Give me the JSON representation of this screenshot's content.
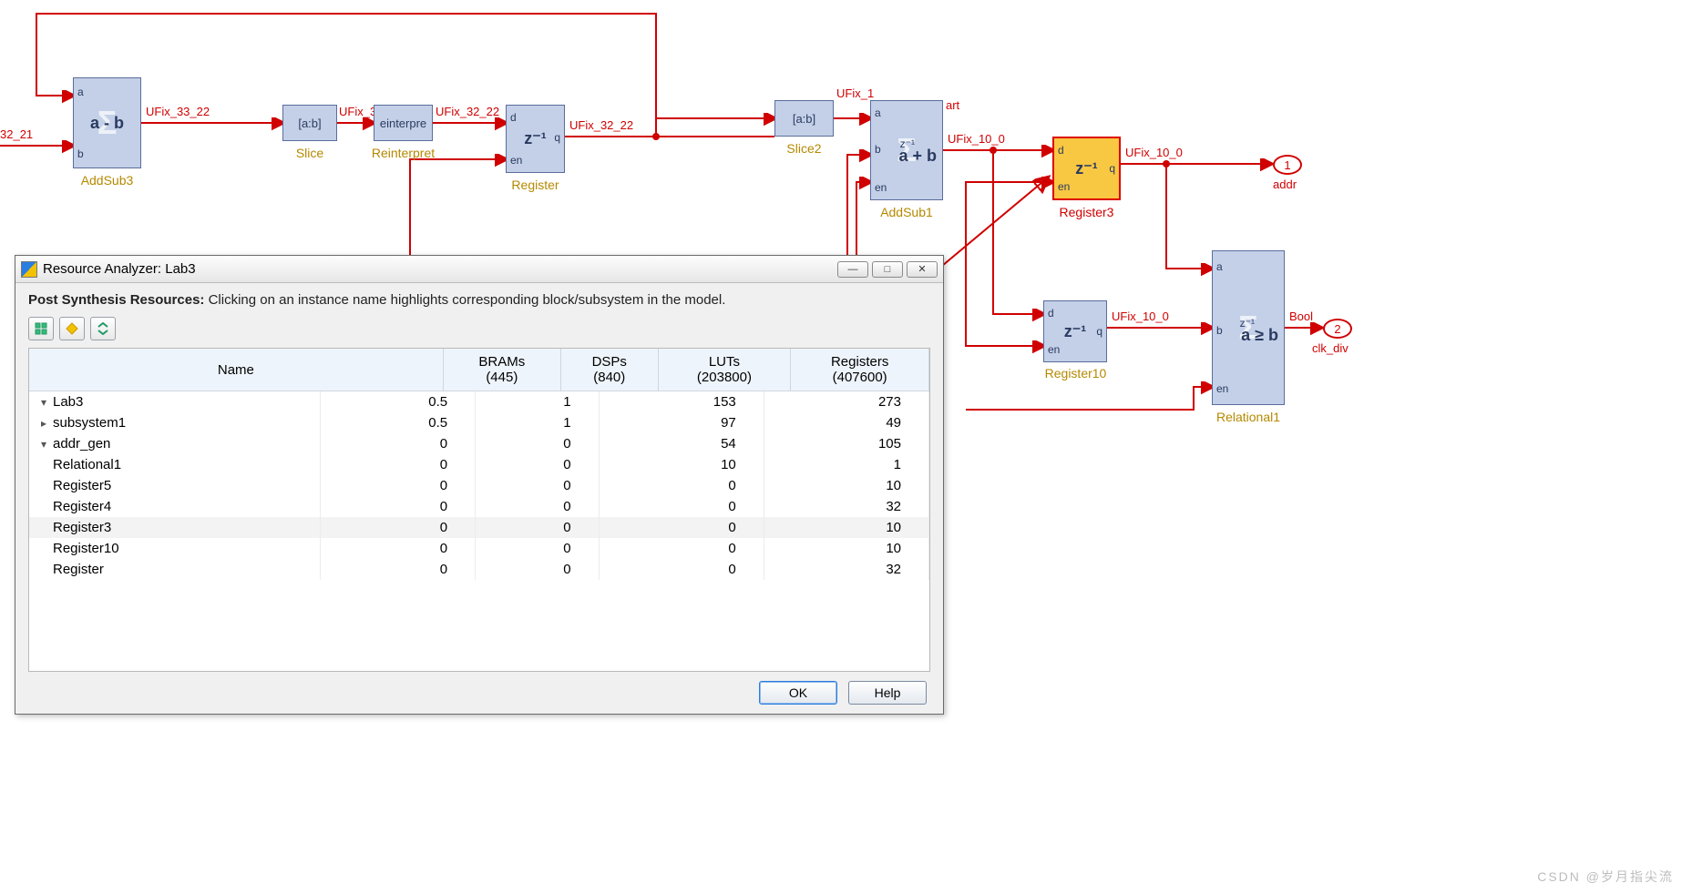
{
  "diagram": {
    "input_signal": "32_21",
    "blocks": {
      "addsub3": {
        "label": "AddSub3",
        "expr": "a - b",
        "in_a": "a",
        "in_b": "b"
      },
      "slice": {
        "label": "Slice",
        "text": "[a:b]"
      },
      "reinterpret": {
        "label": "Reinterpret",
        "text": "einterpre"
      },
      "register": {
        "label": "Register",
        "expr": "z⁻¹",
        "in_d": "d",
        "in_en": "en",
        "out_q": "q"
      },
      "slice2": {
        "label": "Slice2",
        "text": "[a:b]"
      },
      "addsub1": {
        "label": "AddSub1",
        "expr": "a + b",
        "in_a": "a",
        "in_b": "b",
        "in_en": "en",
        "z": "z⁻¹"
      },
      "register3": {
        "label": "Register3",
        "expr": "z⁻¹",
        "in_d": "d",
        "in_en": "en",
        "out_q": "q"
      },
      "register10": {
        "label": "Register10",
        "expr": "z⁻¹",
        "in_d": "d",
        "in_en": "en",
        "out_q": "q"
      },
      "relational1": {
        "label": "Relational1",
        "expr": "a ≥ b",
        "in_a": "a",
        "in_b": "b",
        "in_en": "en",
        "z": "z⁻¹"
      }
    },
    "signals": {
      "s1": "UFix_33_22",
      "s2": "UFix_3",
      "s3": "UFix_32_22",
      "s4": "UFix_32_22",
      "s5": "UFix_1",
      "s6": "art",
      "s7": "UFix_10_0",
      "s8": "UFix_10_0",
      "s9": "UFix_10_0",
      "s10": "Bool"
    },
    "outports": {
      "addr": {
        "num": "1",
        "name": "addr"
      },
      "clkdiv": {
        "num": "2",
        "name": "clk_div"
      }
    }
  },
  "dialog": {
    "title": "Resource Analyzer: Lab3",
    "instruction_bold": "Post Synthesis Resources:",
    "instruction_rest": " Clicking on an instance name highlights corresponding block/subsystem in the model.",
    "columns": {
      "name": "Name",
      "brams": {
        "label": "BRAMs",
        "total": "(445)"
      },
      "dsps": {
        "label": "DSPs",
        "total": "(840)"
      },
      "luts": {
        "label": "LUTs",
        "total": "(203800)"
      },
      "regs": {
        "label": "Registers",
        "total": "(407600)"
      }
    },
    "rows": [
      {
        "name": "Lab3",
        "indent": 0,
        "expand": "▾",
        "brams": "0.5",
        "dsps": "1",
        "luts": "153",
        "regs": "273"
      },
      {
        "name": "subsystem1",
        "indent": 1,
        "expand": "▸",
        "brams": "0.5",
        "dsps": "1",
        "luts": "97",
        "regs": "49"
      },
      {
        "name": "addr_gen",
        "indent": 1,
        "expand": "▾",
        "brams": "0",
        "dsps": "0",
        "luts": "54",
        "regs": "105"
      },
      {
        "name": "Relational1",
        "indent": 2,
        "expand": "",
        "brams": "0",
        "dsps": "0",
        "luts": "10",
        "regs": "1"
      },
      {
        "name": "Register5",
        "indent": 2,
        "expand": "",
        "brams": "0",
        "dsps": "0",
        "luts": "0",
        "regs": "10"
      },
      {
        "name": "Register4",
        "indent": 2,
        "expand": "",
        "brams": "0",
        "dsps": "0",
        "luts": "0",
        "regs": "32"
      },
      {
        "name": "Register3",
        "indent": 2,
        "expand": "",
        "brams": "0",
        "dsps": "0",
        "luts": "0",
        "regs": "10",
        "highlight": true
      },
      {
        "name": "Register10",
        "indent": 2,
        "expand": "",
        "brams": "0",
        "dsps": "0",
        "luts": "0",
        "regs": "10"
      },
      {
        "name": "Register",
        "indent": 2,
        "expand": "",
        "brams": "0",
        "dsps": "0",
        "luts": "0",
        "regs": "32"
      }
    ],
    "buttons": {
      "ok": "OK",
      "help": "Help"
    }
  },
  "watermark": "CSDN @岁月指尖流"
}
